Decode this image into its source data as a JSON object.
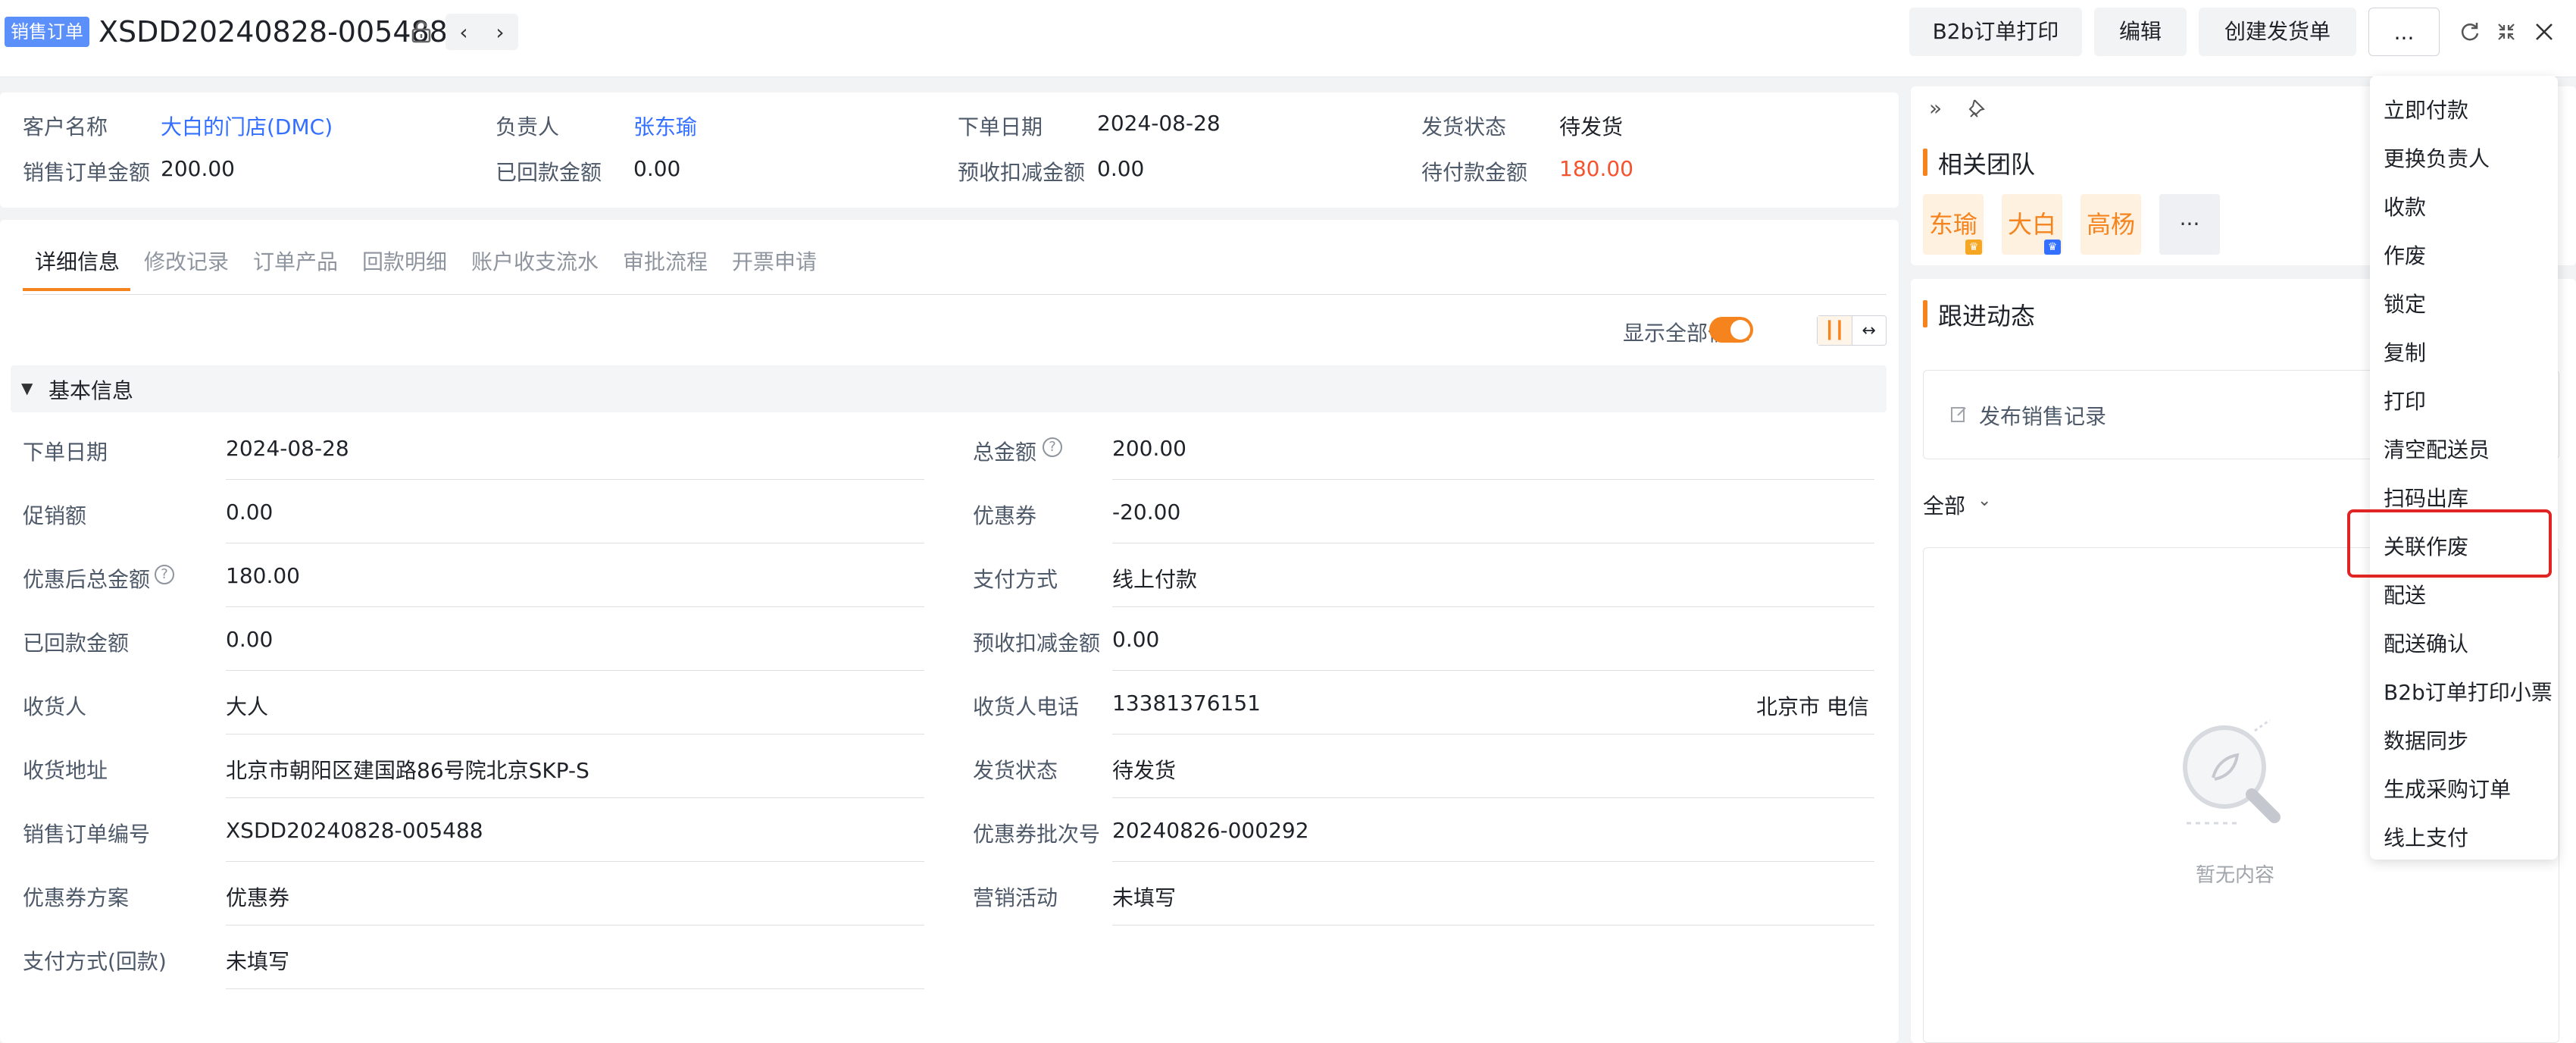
{
  "header": {
    "tag": "销售订单",
    "order_no": "XSDD20240828-005488",
    "buttons": {
      "b2b_print": "B2b订单打印",
      "edit": "编辑",
      "create_shipment": "创建发货单",
      "more": "..."
    }
  },
  "summary": {
    "row1": [
      {
        "label": "客户名称",
        "value": "大白的门店(DMC)"
      },
      {
        "label": "负责人",
        "value": "张东瑜"
      },
      {
        "label": "下单日期",
        "value": "2024-08-28"
      },
      {
        "label": "发货状态",
        "value": "待发货"
      }
    ],
    "row2": [
      {
        "label": "销售订单金额",
        "value": "200.00"
      },
      {
        "label": "已回款金额",
        "value": "0.00"
      },
      {
        "label": "预收扣减金额",
        "value": "0.00"
      },
      {
        "label": "待付款金额",
        "value": "180.00"
      }
    ]
  },
  "tabs": [
    "详细信息",
    "修改记录",
    "订单产品",
    "回款明细",
    "账户收支流水",
    "审批流程",
    "开票申请"
  ],
  "toolbar": {
    "show_all_label": "显示全部信息"
  },
  "section": {
    "title": "基本信息"
  },
  "fields_left": [
    {
      "label": "下单日期",
      "value": "2024-08-28"
    },
    {
      "label": "促销额",
      "value": "0.00"
    },
    {
      "label": "优惠后总金额",
      "value": "180.00"
    },
    {
      "label": "已回款金额",
      "value": "0.00"
    },
    {
      "label": "收货人",
      "value": "大人"
    },
    {
      "label": "收货地址",
      "value": "北京市朝阳区建国路86号院北京SKP-S"
    },
    {
      "label": "销售订单编号",
      "value": "XSDD20240828-005488"
    },
    {
      "label": "优惠券方案",
      "value": "优惠券"
    },
    {
      "label": "支付方式(回款)",
      "value": "未填写"
    }
  ],
  "fields_right": [
    {
      "label": "总金额",
      "value": "200.00"
    },
    {
      "label": "优惠券",
      "value": "-20.00"
    },
    {
      "label": "支付方式",
      "value": "线上付款"
    },
    {
      "label": "预收扣减金额",
      "value": "0.00"
    },
    {
      "label": "收货人电话",
      "value": "13381376151",
      "extra": "北京市 电信"
    },
    {
      "label": "发货状态",
      "value": "待发货"
    },
    {
      "label": "优惠券批次号",
      "value": "20240826-000292"
    },
    {
      "label": "营销活动",
      "value": "未填写"
    }
  ],
  "right_panel": {
    "team_title": "相关团队",
    "team_members": [
      "东瑜",
      "大白",
      "高杨"
    ],
    "more": "···",
    "follow_title": "跟进动态",
    "publish_label": "发布销售记录",
    "filter_label": "全部",
    "empty_text": "暂无内容"
  },
  "menu": {
    "items": [
      "立即付款",
      "更换负责人",
      "收款",
      "作废",
      "锁定",
      "复制",
      "打印",
      "清空配送员",
      "扫码出库",
      "关联作废",
      "配送",
      "配送确认",
      "B2b订单打印小票",
      "数据同步",
      "生成采购订单",
      "线上支付"
    ],
    "highlighted_index": 9
  },
  "colors": {
    "accent": "#f5841f",
    "link": "#3370ff",
    "danger": "#f5522d",
    "highlight_border": "#e02424"
  }
}
